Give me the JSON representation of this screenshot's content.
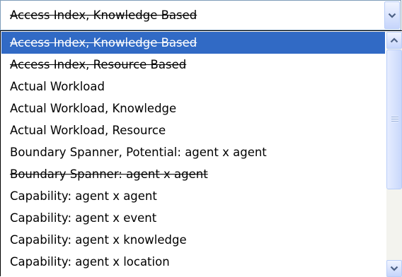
{
  "combo": {
    "selected_value": "Access Index, Knowledge Based",
    "icon": "chevron-down-icon"
  },
  "list": {
    "items": [
      {
        "label": "Access Index, Knowledge Based",
        "struck": true,
        "selected": true
      },
      {
        "label": "Access Index, Resource Based",
        "struck": true,
        "selected": false
      },
      {
        "label": "Actual Workload",
        "struck": false,
        "selected": false
      },
      {
        "label": "Actual Workload, Knowledge",
        "struck": false,
        "selected": false
      },
      {
        "label": "Actual Workload, Resource",
        "struck": false,
        "selected": false
      },
      {
        "label": "Boundary Spanner, Potential: agent x agent",
        "struck": false,
        "selected": false
      },
      {
        "label": "Boundary Spanner: agent x agent",
        "struck": true,
        "selected": false
      },
      {
        "label": "Capability: agent x agent",
        "struck": false,
        "selected": false
      },
      {
        "label": "Capability: agent x event",
        "struck": false,
        "selected": false
      },
      {
        "label": "Capability: agent x knowledge",
        "struck": false,
        "selected": false
      },
      {
        "label": "Capability: agent x location",
        "struck": false,
        "selected": false
      }
    ]
  },
  "scrollbar": {
    "up_icon": "chevron-up-icon",
    "down_icon": "chevron-down-icon",
    "thumb_grip_icon": "grip-icon"
  },
  "colors": {
    "selection": "#316ac5",
    "border": "#7f9db9",
    "button_blue": "#c6d5fb"
  }
}
